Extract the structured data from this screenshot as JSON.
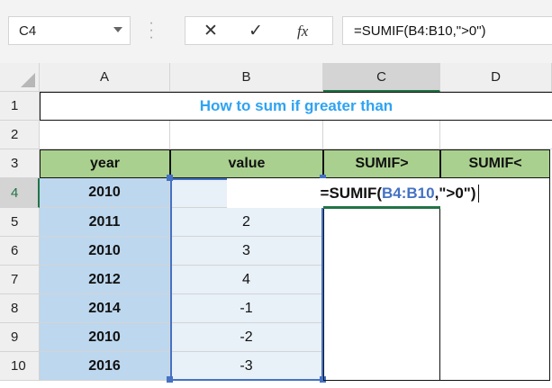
{
  "name_box": {
    "value": "C4",
    "dropdown_icon": "chevron-down-icon"
  },
  "formula_bar": {
    "cancel_icon": "✕",
    "enter_icon": "✓",
    "fx_icon": "fx",
    "formula": "=SUMIF(B4:B10,\">0\")"
  },
  "columns": [
    "A",
    "B",
    "C",
    "D"
  ],
  "rows": [
    "1",
    "2",
    "3",
    "4",
    "5",
    "6",
    "7",
    "8",
    "9",
    "10"
  ],
  "title": "How to sum if greater than",
  "table_headers": {
    "year": "year",
    "value": "value",
    "sumif_gt": "SUMIF>",
    "sumif_lt": "SUMIF<"
  },
  "years": [
    "2010",
    "2011",
    "2010",
    "2012",
    "2014",
    "2010",
    "2016"
  ],
  "values": [
    "",
    "2",
    "3",
    "4",
    "-1",
    "-2",
    "-3"
  ],
  "editing": {
    "prefix": "=SUMIF(",
    "range": "B4:B10",
    "suffix": ",\">0\")"
  },
  "colors": {
    "title_blue": "#2ea3f2",
    "header_green": "#a9d08e",
    "year_blue": "#bdd7ee",
    "range_blue": "#4472c4",
    "selection_green": "#217346"
  }
}
